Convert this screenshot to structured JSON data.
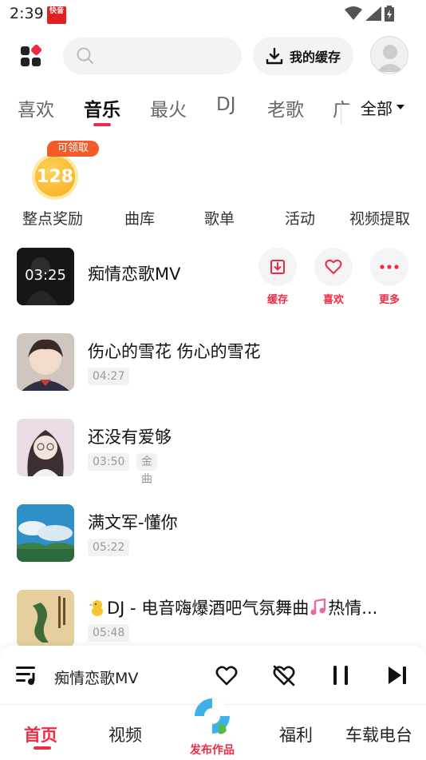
{
  "status": {
    "time": "2:39",
    "app_icon_text": "快音"
  },
  "top": {
    "cache_label": "我的缓存",
    "search_placeholder": ""
  },
  "tabs": [
    "喜欢",
    "音乐",
    "最火",
    "DJ",
    "老歌",
    "广"
  ],
  "tab_all": "全部",
  "quick": {
    "coin_value": "128",
    "claim_badge": "可领取",
    "items": [
      "整点奖励",
      "曲库",
      "歌单",
      "活动",
      "视频提取"
    ]
  },
  "songs": [
    {
      "title": "痴情恋歌MV",
      "duration": "03:25"
    },
    {
      "title": "伤心的雪花 伤心的雪花",
      "duration": "04:27"
    },
    {
      "title": "还没有爱够",
      "duration": "03:50",
      "tag": "金曲"
    },
    {
      "title": "满文军-懂你",
      "duration": "05:22"
    },
    {
      "title": "DJ - 电音嗨爆酒吧气氛舞曲",
      "title_suffix": "热情...",
      "duration": "05:48"
    }
  ],
  "song_actions": [
    "缓存",
    "喜欢",
    "更多"
  ],
  "player": {
    "title": "痴情恋歌MV"
  },
  "nav": {
    "home": "首页",
    "video": "视频",
    "publish": "发布作品",
    "welfare": "福利",
    "car_radio": "车载电台"
  },
  "colors": {
    "accent": "#ee2b45",
    "coin": "#f9a91a",
    "badge": "#f45b2b"
  }
}
